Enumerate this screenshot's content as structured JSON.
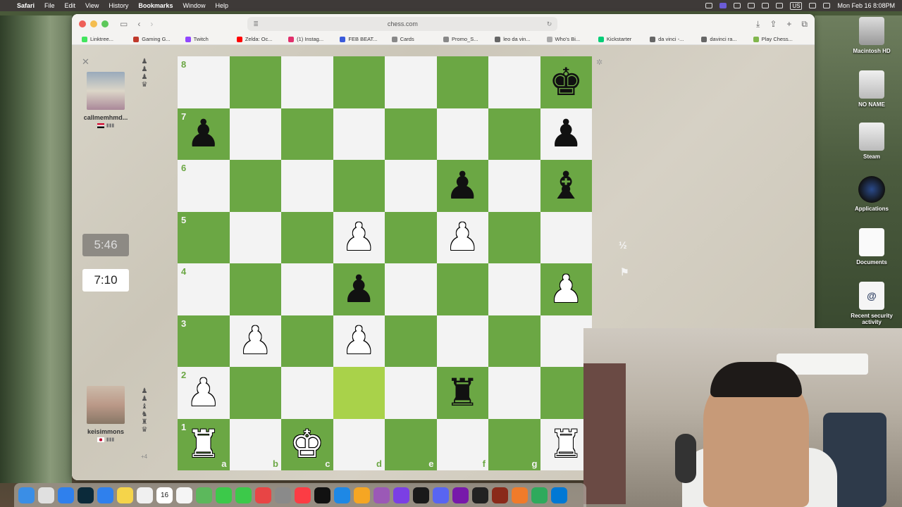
{
  "menubar": {
    "app": "Safari",
    "menus": [
      "File",
      "Edit",
      "View",
      "History",
      "Bookmarks",
      "Window",
      "Help"
    ],
    "input_source": "US",
    "datetime": "Mon Feb 16 8:08PM"
  },
  "browser": {
    "url": "chess.com",
    "bookmarks": [
      {
        "label": "Linktree...",
        "color": "#43e55e"
      },
      {
        "label": "Gaming G...",
        "color": "#c0392b"
      },
      {
        "label": "Twitch",
        "color": "#9146ff"
      },
      {
        "label": "Zelda: Oc...",
        "color": "#ff0000"
      },
      {
        "label": "(1) Instag...",
        "color": "#e1306c"
      },
      {
        "label": "FEB BEAT...",
        "color": "#3b5bdb"
      },
      {
        "label": "Cards",
        "color": "#888888"
      },
      {
        "label": "Promo_S...",
        "color": "#888888"
      },
      {
        "label": "leo da vin...",
        "color": "#666666"
      },
      {
        "label": "Who's Bi...",
        "color": "#aaaaaa"
      },
      {
        "label": "Kickstarter",
        "color": "#05ce78"
      },
      {
        "label": "da vinci -...",
        "color": "#666666"
      },
      {
        "label": "davinci ra...",
        "color": "#666666"
      },
      {
        "label": "Play Chess...",
        "color": "#81b64c"
      }
    ]
  },
  "game": {
    "opponent": {
      "name": "callmemhmd...",
      "captures": [
        "♟",
        "♟",
        "♟",
        "♛"
      ]
    },
    "player": {
      "name": "keisimmons",
      "captures": [
        "♟",
        "♟",
        "♝",
        "♞",
        "♜",
        "♛"
      ],
      "material": "+4"
    },
    "opponent_clock": "5:46",
    "player_clock": "7:10",
    "draw_label": "½",
    "resign_icon": "flag-icon",
    "highlight_square": "d2",
    "pieces": {
      "h8": "bK",
      "a7": "bP",
      "h7": "bP",
      "f6": "bP",
      "h6": "bB",
      "d5": "wP",
      "f5": "wP",
      "d4": "bP",
      "h4": "wP",
      "b3": "wP",
      "d3": "wP",
      "a2": "wP",
      "f2": "bR",
      "a1": "wR",
      "c1": "wK",
      "h1": "wR"
    },
    "files": [
      "a",
      "b",
      "c",
      "d",
      "e",
      "f",
      "g",
      "h"
    ],
    "ranks": [
      "8",
      "7",
      "6",
      "5",
      "4",
      "3",
      "2",
      "1"
    ]
  },
  "desktop": {
    "icons": [
      "Macintosh HD",
      "NO NAME",
      "Steam",
      "Applications",
      "Documents",
      "Recent security activity"
    ]
  },
  "dock": {
    "apps": [
      "Finder",
      "Launchpad",
      "Safari",
      "Cursor",
      "Mail",
      "Notes",
      "Freeform",
      "Calendar",
      "Reminders",
      "Maps",
      "FaceTime",
      "Messages",
      "News",
      "Settings",
      "Music",
      "TV",
      "App Store",
      "Photos",
      "Podcasts",
      "Feedback",
      "Final Cut",
      "Discord",
      "OneNote",
      "Terminal",
      "Game",
      "Sublime",
      "Xcode-tool",
      "VS Code"
    ],
    "calendar_day": "16",
    "colors": [
      "#3a8ee6",
      "#e0e0e0",
      "#2f80ed",
      "#0b2a3a",
      "#2f80ed",
      "#f5d44a",
      "#f0f0f0",
      "#ffffff",
      "#f5f5f5",
      "#5cb85c",
      "#3cc94a",
      "#3cc94a",
      "#e84545",
      "#8a8a8a",
      "#fc3c44",
      "#111111",
      "#1e88e5",
      "#f5a623",
      "#9b59b6",
      "#7b3fe4",
      "#1a1a1a",
      "#5865f2",
      "#7719aa",
      "#222222",
      "#8a2a1a",
      "#f07b2a",
      "#2eaa5c",
      "#0078d4"
    ]
  }
}
